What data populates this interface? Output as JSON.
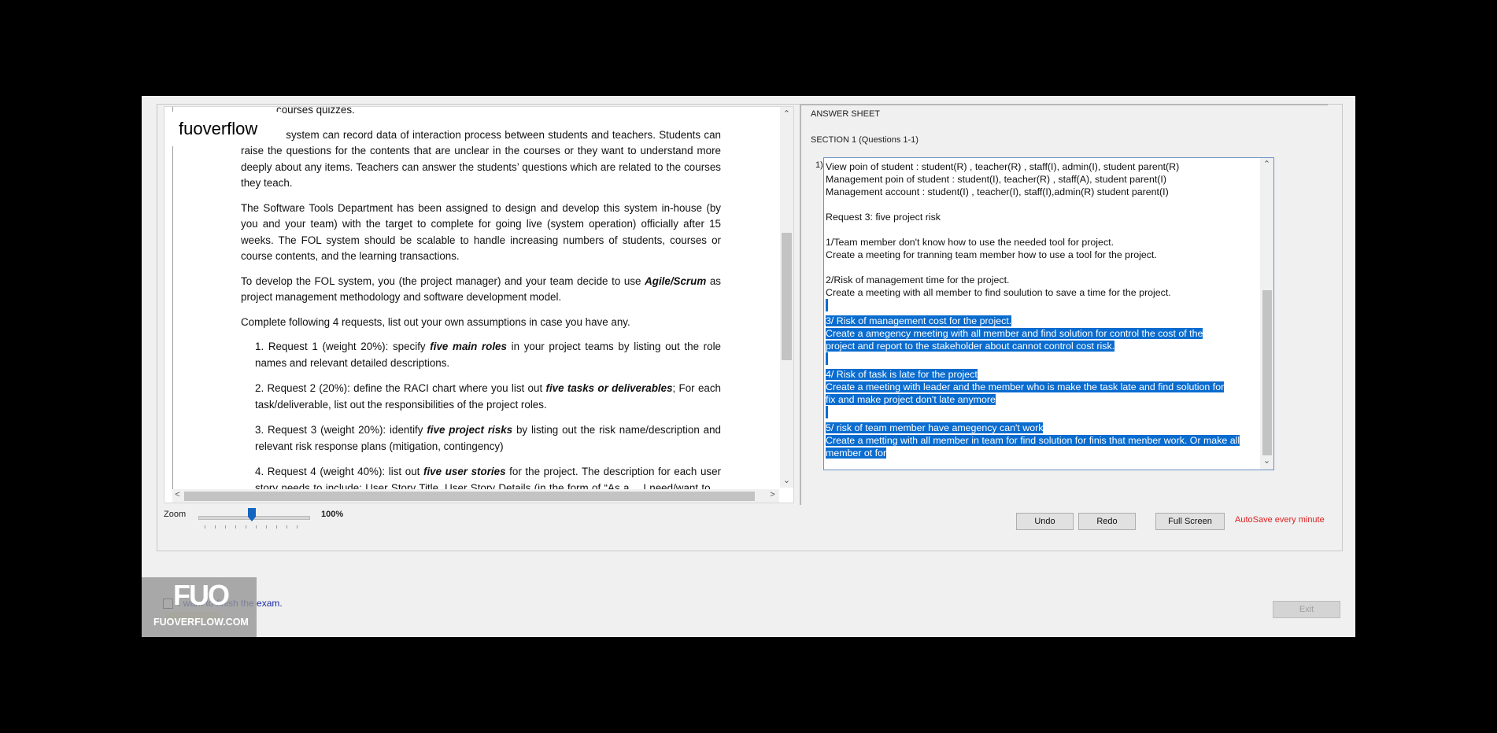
{
  "logo_text": "fuoverflow",
  "document": {
    "top_cut": "courses  quizzes.",
    "paragraphs": [
      "The FOL system can record data of interaction process between students and teachers. Students can raise the questions for the contents that are unclear in the courses or they want to understand more deeply about any items. Teachers can answer the students’ questions which are related to the courses they teach.",
      "The Software Tools Department has been assigned to design and develop this system in-house (by you and your team) with the target to complete for going live (system operation) officially after 15 weeks. The FOL system should be scalable to handle increasing numbers of students, courses or course contents, and the learning transactions.",
      "Complete following 4 requests, list out your own assumptions in case you have any."
    ],
    "agile_para": {
      "before": "To develop the FOL system, you (the project manager) and your team decide to use ",
      "bold": "Agile/Scrum",
      "after": " as project management methodology and software development model."
    },
    "requests": [
      {
        "before": "1. Request 1 (weight 20%): specify ",
        "bold": "five main roles",
        "after": " in your project teams by listing out the role names and relevant detailed descriptions."
      },
      {
        "before": "2. Request 2 (20%): define the RACI chart where you list out ",
        "bold": "five tasks or deliverables",
        "after": "; For each task/deliverable, list out the responsibilities of the project roles."
      },
      {
        "before": "3. Request 3 (weight 20%): identify ",
        "bold": "five project risks",
        "after": " by listing out the risk name/description and relevant risk response plans (mitigation, contingency)"
      },
      {
        "before": "4. Request 4 (weight 40%): list out ",
        "bold": "five user stories",
        "after": " for the project. The description for each user story needs to include: User Story Title, User Story Details (in the form of “As a… I need/want to… so that…”), and Acceptance Criteria (list out at least two criteria for each user story)"
      }
    ]
  },
  "answer": {
    "title": "ANSWER SHEET",
    "section": "SECTION 1 (Questions 1-1)",
    "question_number": "1)",
    "lines": [
      {
        "text": "View poin of student : student(R) , teacher(R) , staff(I), admin(I), student parent(R)",
        "selected": false
      },
      {
        "text": "Management poin of student : student(I), teacher(R) , staff(A), student parent(I)",
        "selected": false
      },
      {
        "text": "Management account : student(I) , teacher(I), staff(I),admin(R) student parent(I)",
        "selected": false
      },
      {
        "text": "",
        "selected": false
      },
      {
        "text": "Request 3: five project risk",
        "selected": false
      },
      {
        "text": "",
        "selected": false
      },
      {
        "text": "1/Team member don't know how to use the needed tool for project.",
        "selected": false
      },
      {
        "text": "Create a meeting for tranning team member how to use a tool for the project.",
        "selected": false
      },
      {
        "text": "",
        "selected": false
      },
      {
        "text": "2/Risk of management time for the project.",
        "selected": false
      },
      {
        "text": "Create a meeting with all member to find soulution to save a time for the project.",
        "selected": false
      },
      {
        "text": "",
        "selected": true
      },
      {
        "text": "3/ Risk of management cost for the project.",
        "selected": true
      },
      {
        "text": "Create a amegency meeting  with all member and find solution for control the cost of the",
        "selected": true
      },
      {
        "text": "project and report to the stakeholder about cannot control cost risk.",
        "selected": true
      },
      {
        "text": "",
        "selected": true
      },
      {
        "text": "4/ Risk of task is late for the project",
        "selected": true
      },
      {
        "text": "Create a meeting with leader and the member who is make the task late and find solution for",
        "selected": true
      },
      {
        "text": "fix and make project don't late anymore",
        "selected": true
      },
      {
        "text": "",
        "selected": true
      },
      {
        "text": "5/ risk of team member have amegency can't work",
        "selected": true
      },
      {
        "text": "Create a metting with all member in team for find solution for finis that menber work. Or make all",
        "selected": true
      },
      {
        "text": "member ot for",
        "selected": true
      }
    ]
  },
  "zoom": {
    "label": "Zoom",
    "value": "100%",
    "level_percent": 100
  },
  "buttons": {
    "undo": "Undo",
    "redo": "Redo",
    "fullscreen": "Full Screen",
    "autosave": "AutoSave every minute"
  },
  "finish": {
    "label": "I want to finish the exam."
  },
  "exit_label": "Exit",
  "watermark": {
    "big": "FUO",
    "small": "FUOVERFLOW.COM"
  }
}
